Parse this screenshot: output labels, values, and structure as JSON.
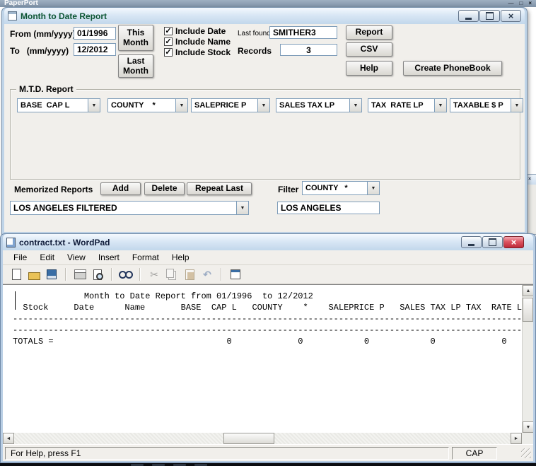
{
  "desktop": {
    "background_title": "PaperPort"
  },
  "mtd": {
    "title": "Month to Date Report",
    "from_label": "From (mm/yyyy)",
    "from_value": "01/1996",
    "to_label": "To   (mm/yyyy)",
    "to_value": "12/2012",
    "this_month": "This Month",
    "last_month": "Last Month",
    "include_date": "Include Date",
    "include_name": "Include Name",
    "include_stock": "Include Stock",
    "last_found_label": "Last found",
    "last_found_value": "SMITHER3",
    "records_label": "Records",
    "records_value": "3",
    "report_btn": "Report",
    "csv_btn": "CSV",
    "help_btn": "Help",
    "phonebook_btn": "Create PhoneBook",
    "group_title": "M.T.D. Report",
    "fields": [
      "BASE  CAP L",
      "COUNTY    *",
      "SALEPRICE P",
      "SALES TAX LP",
      "TAX  RATE LP",
      "TAXABLE $ P"
    ],
    "memorized_label": "Memorized Reports",
    "add_btn": "Add",
    "delete_btn": "Delete",
    "repeat_btn": "Repeat Last",
    "filter_label": "Filter",
    "filter_combo": "COUNTY   *",
    "memorized_combo": "LOS ANGELES FILTERED",
    "filter_value": "LOS ANGELES"
  },
  "wordpad": {
    "title": "contract.txt - WordPad",
    "menu": [
      "File",
      "Edit",
      "View",
      "Insert",
      "Format",
      "Help"
    ],
    "doc_lines": [
      "              Month to Date Report from 01/1996  to 12/2012",
      "",
      "  Stock     Date      Name       BASE  CAP L   COUNTY    *    SALEPRICE P   SALES TAX LP TAX  RATE LP",
      "--------------------------------------------------------------------------------------------------------",
      "",
      "--------------------------------------------------------------------------------------------------------",
      "TOTALS =                                  0             0            0            0             0"
    ],
    "status_left": "For Help, press F1",
    "caps": "CAP"
  }
}
